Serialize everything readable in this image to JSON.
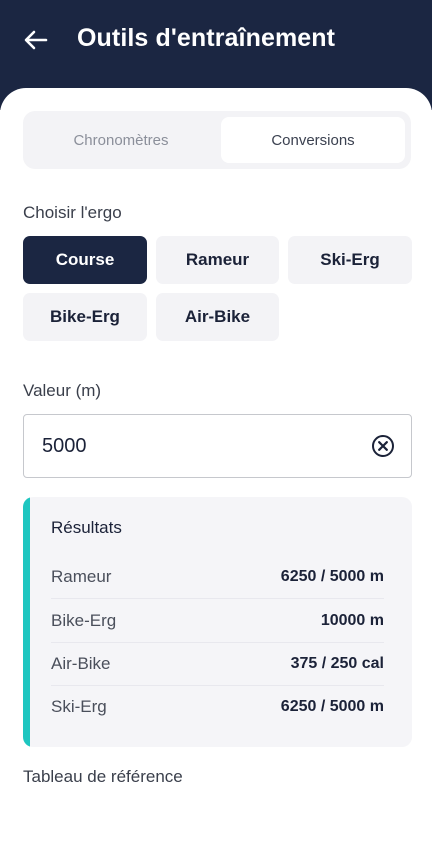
{
  "header": {
    "title": "Outils d'entraînement",
    "back_icon": "arrow-left-icon"
  },
  "tabs": [
    {
      "label": "Chronomètres",
      "active": false
    },
    {
      "label": "Conversions",
      "active": true
    }
  ],
  "ergo": {
    "label": "Choisir l'ergo",
    "options": [
      "Course",
      "Rameur",
      "Ski-Erg",
      "Bike-Erg",
      "Air-Bike"
    ],
    "selected": "Course"
  },
  "value_field": {
    "label": "Valeur (m)",
    "value": "5000",
    "clear_icon": "clear-circle-icon"
  },
  "results": {
    "title": "Résultats",
    "rows": [
      {
        "label": "Rameur",
        "value": "6250 / 5000 m"
      },
      {
        "label": "Bike-Erg",
        "value": "10000 m"
      },
      {
        "label": "Air-Bike",
        "value": "375 / 250 cal"
      },
      {
        "label": "Ski-Erg",
        "value": "6250 / 5000 m"
      }
    ]
  },
  "reference": {
    "label": "Tableau de référence"
  },
  "colors": {
    "header_bg": "#1b2642",
    "accent": "#1ec6c0",
    "chip_active": "#1b2642",
    "chip_bg": "#f3f3f6"
  }
}
